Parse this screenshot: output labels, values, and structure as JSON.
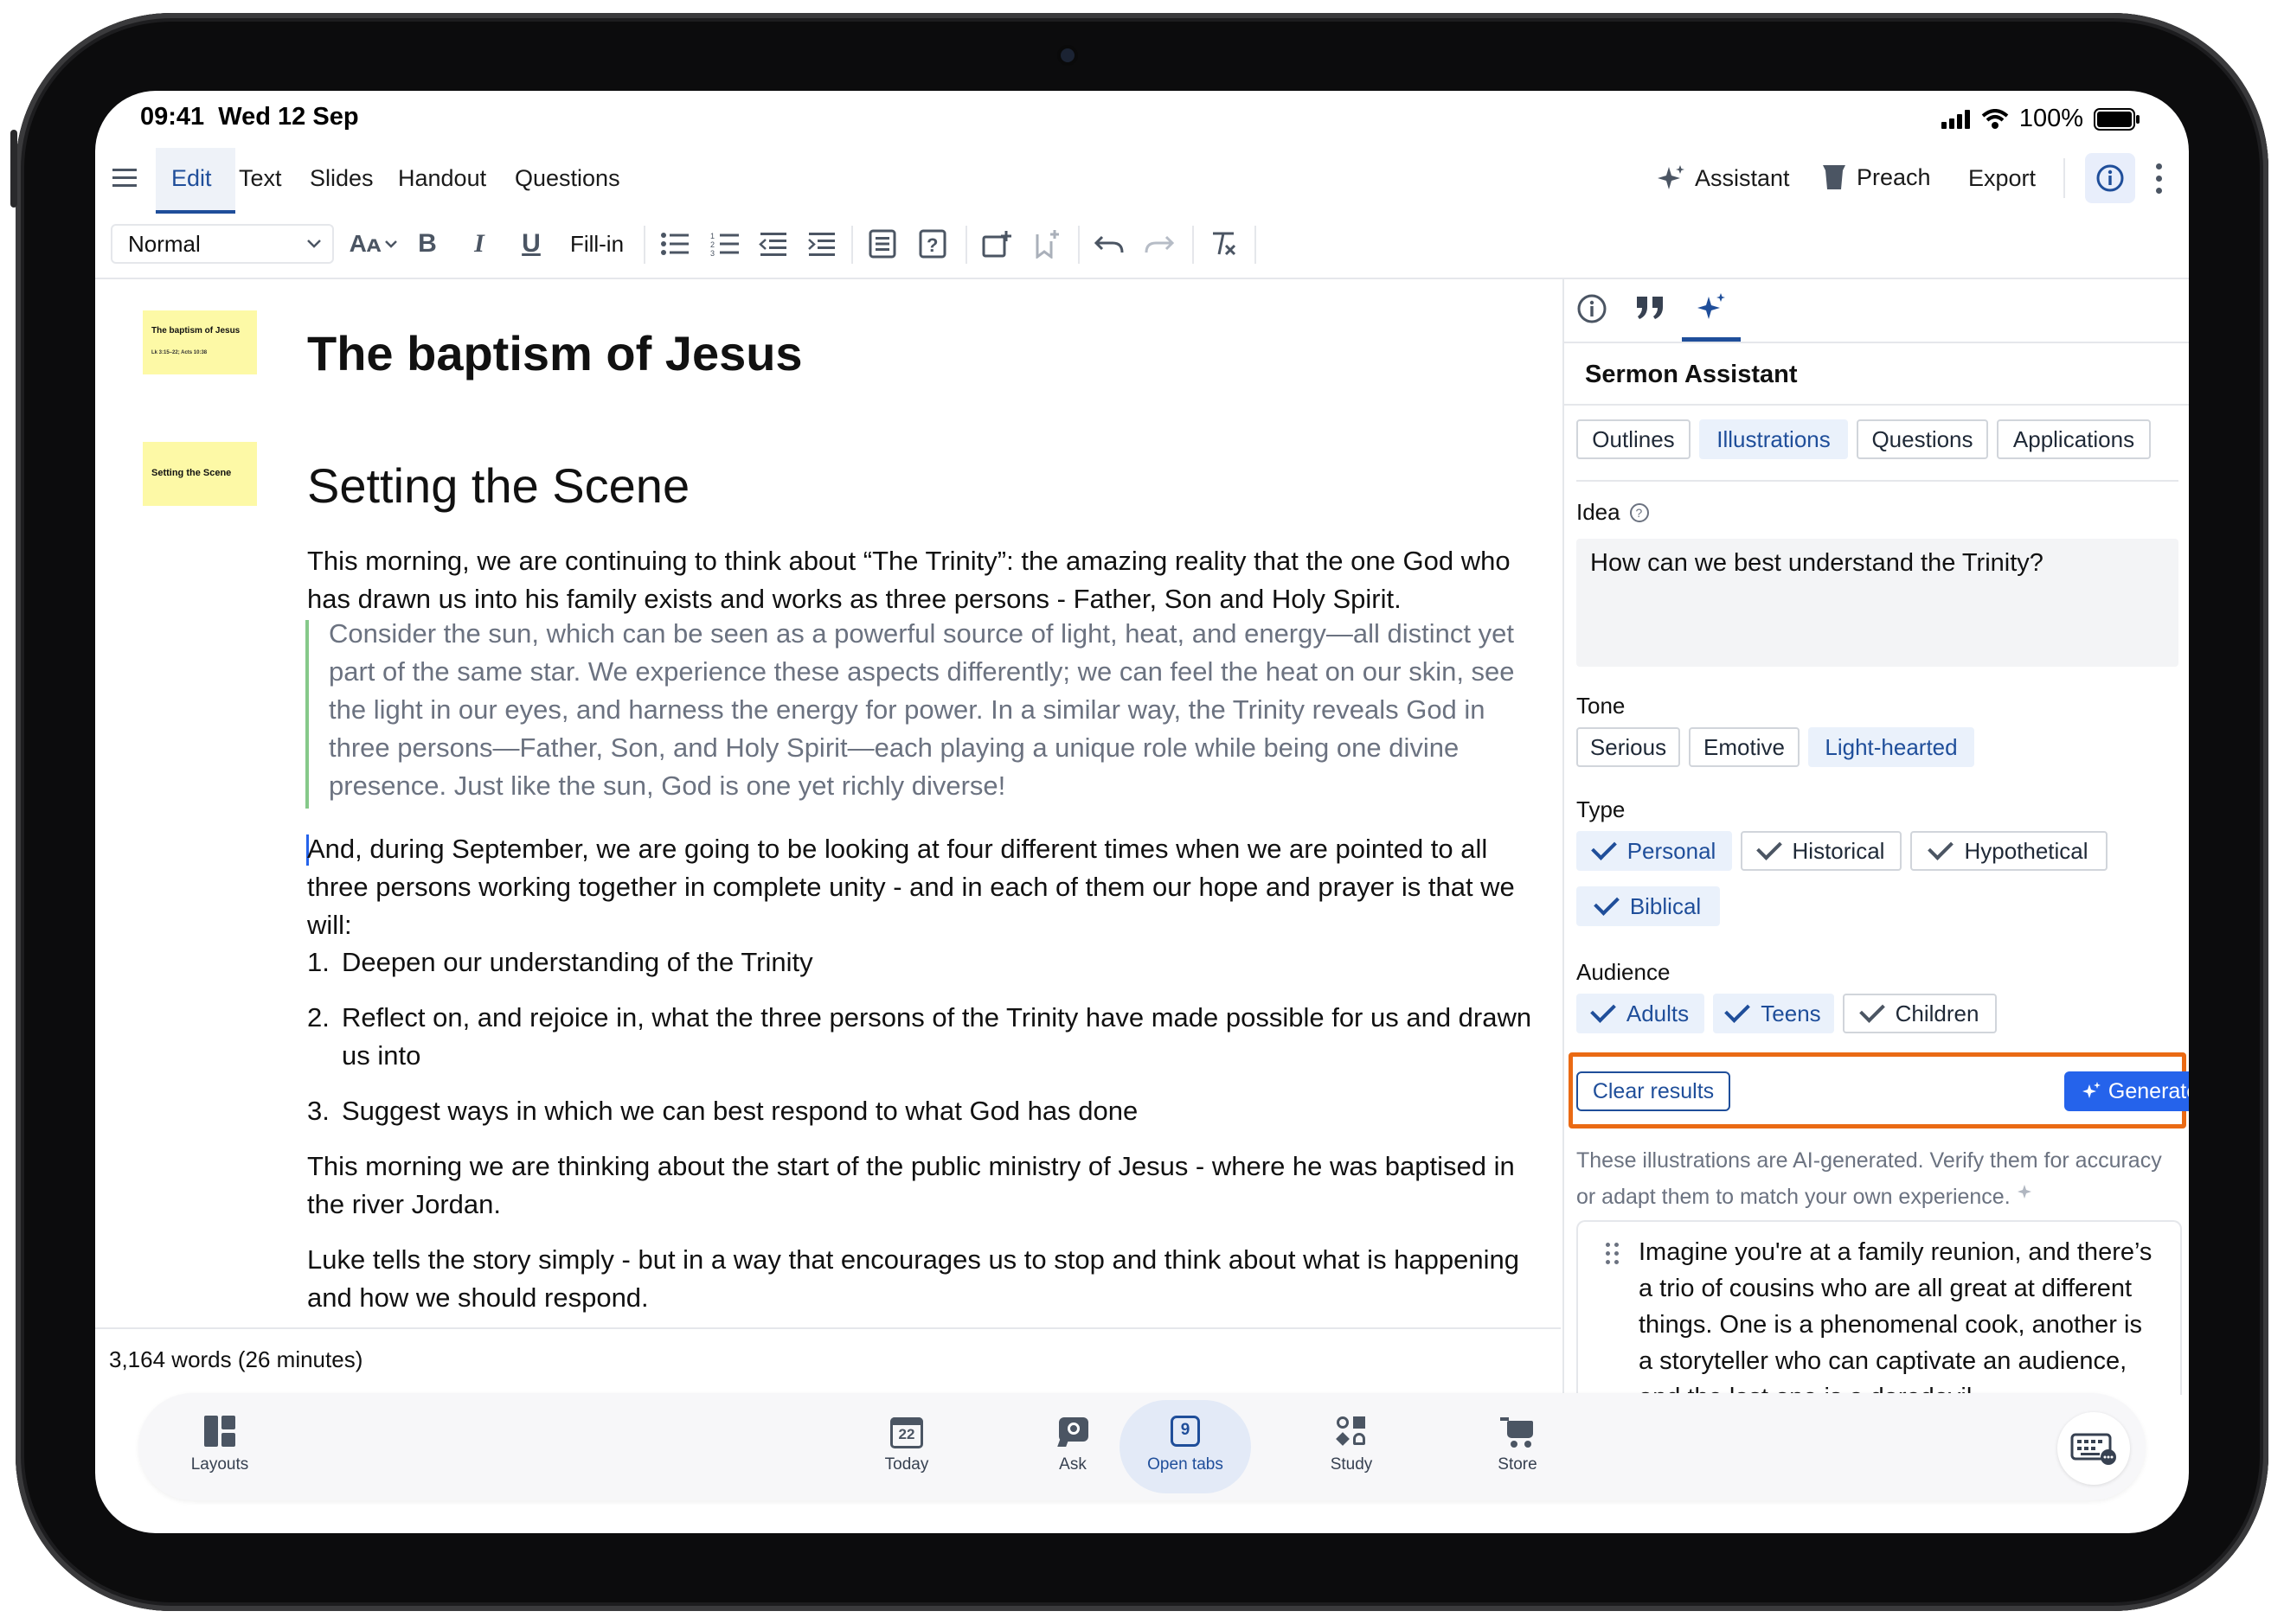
{
  "status": {
    "time": "09:41",
    "date": "Wed 12 Sep",
    "battery": "100%"
  },
  "menu": {
    "items": [
      "Edit",
      "Text",
      "Slides",
      "Handout",
      "Questions"
    ],
    "active": "Edit",
    "right": {
      "assistant": "Assistant",
      "preach": "Preach",
      "export": "Export"
    }
  },
  "toolbar": {
    "style_select": "Normal",
    "fill_in": "Fill-in"
  },
  "document": {
    "title": "The baptism of Jesus",
    "slides": [
      {
        "title": "The baptism of Jesus",
        "subtitle": "Lk 3:15–22; Acts 10:38"
      },
      {
        "title": "Setting the Scene"
      }
    ],
    "section_heading": "Setting the Scene",
    "p1": "This morning, we are continuing to think about “The Trinity”: the amazing reality that the one God who has drawn us into his family exists and works as three persons - Father, Son and Holy Spirit.",
    "quote": "Consider the sun, which can be seen as a powerful source of light, heat, and energy—all distinct yet part of the same star. We experience these aspects differently; we can feel the heat on our skin, see the light in our eyes, and harness the energy for power. In a similar way, the Trinity reveals God in three persons—Father, Son, and Holy Spirit—each playing a unique role while being one divine presence. Just like the sun, God is one yet richly diverse!",
    "p2": "And, during September, we are going to be looking at four different times when we are pointed to all three persons working together in complete unity - and in each of them our hope and prayer is that we will:",
    "list": [
      "Deepen our understanding of the Trinity",
      "Reflect on, and rejoice in, what the three persons of the Trinity have made possible for us and drawn us into",
      "Suggest ways in which we can best respond to what God has done"
    ],
    "p3": "This morning we are thinking about the start of the public ministry of Jesus - where he was  baptised in the river Jordan.",
    "p4": "Luke tells the story simply - but in a way that encourages us to stop and think about what is happening and how we should respond.",
    "word_count": "3,164 words (26 minutes)"
  },
  "assistant": {
    "title": "Sermon Assistant",
    "modes": [
      "Outlines",
      "Illustrations",
      "Questions",
      "Applications"
    ],
    "active_mode": "Illustrations",
    "idea_label": "Idea",
    "idea_value": "How can we best understand the Trinity?",
    "tone_label": "Tone",
    "tones": [
      "Serious",
      "Emotive",
      "Light-hearted"
    ],
    "active_tone": "Light-hearted",
    "type_label": "Type",
    "types": [
      {
        "label": "Personal",
        "checked": true
      },
      {
        "label": "Historical",
        "checked": false
      },
      {
        "label": "Hypothetical",
        "checked": false
      },
      {
        "label": "Biblical",
        "checked": true
      }
    ],
    "audience_label": "Audience",
    "audiences": [
      {
        "label": "Adults",
        "checked": true
      },
      {
        "label": "Teens",
        "checked": true
      },
      {
        "label": "Children",
        "checked": false
      }
    ],
    "clear_label": "Clear results",
    "generate_label": "Generate more",
    "disclaimer": "These illustrations are AI-generated. Verify them for accuracy or adapt them to match your own experience.",
    "result": "Imagine you're at a family reunion, and there’s a trio of cousins who are all great at different things. One is a phenomenal cook, another is a storyteller who can captivate an audience, and the last one is a daredevil"
  },
  "tabbar": {
    "items": [
      {
        "label": "Layouts",
        "icon": "layouts-icon"
      },
      {
        "label": "Today",
        "icon": "calendar-icon",
        "badge": "22"
      },
      {
        "label": "Ask",
        "icon": "ask-icon"
      },
      {
        "label": "Open tabs",
        "icon": "tabs-icon",
        "badge": "9"
      },
      {
        "label": "Study",
        "icon": "study-icon"
      },
      {
        "label": "Store",
        "icon": "cart-icon"
      }
    ],
    "active": "Open tabs"
  },
  "colors": {
    "accent": "#2563eb",
    "highlight": "#ea6a14",
    "slide_bg": "#fdf9a6",
    "chip_on": "#eaf1fb",
    "quote_bar": "#86c98a"
  }
}
